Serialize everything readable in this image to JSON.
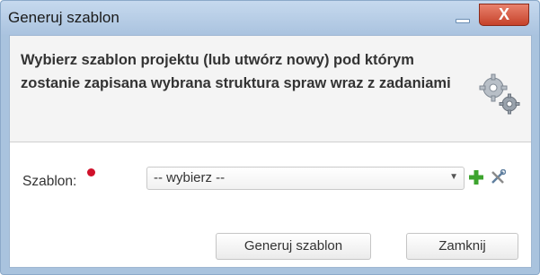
{
  "window": {
    "title": "Generuj szablon",
    "close_label": "X"
  },
  "header": {
    "heading": "Wybierz szablon projektu (lub utwórz nowy) pod którym zostanie zapisana wybrana struktura spraw wraz z zadaniami",
    "icon": "gears-icon"
  },
  "form": {
    "template_label": "Szablon:",
    "template_select_value": "-- wybierz --",
    "add_icon": "plus-icon",
    "manage_icon": "tools-icon"
  },
  "footer": {
    "generate_label": "Generuj szablon",
    "close_label": "Zamknij"
  },
  "colors": {
    "titlebar": "#aac3df",
    "close_button": "#c6422a",
    "required_marker": "#d0112b",
    "add_icon": "#3da42e"
  }
}
